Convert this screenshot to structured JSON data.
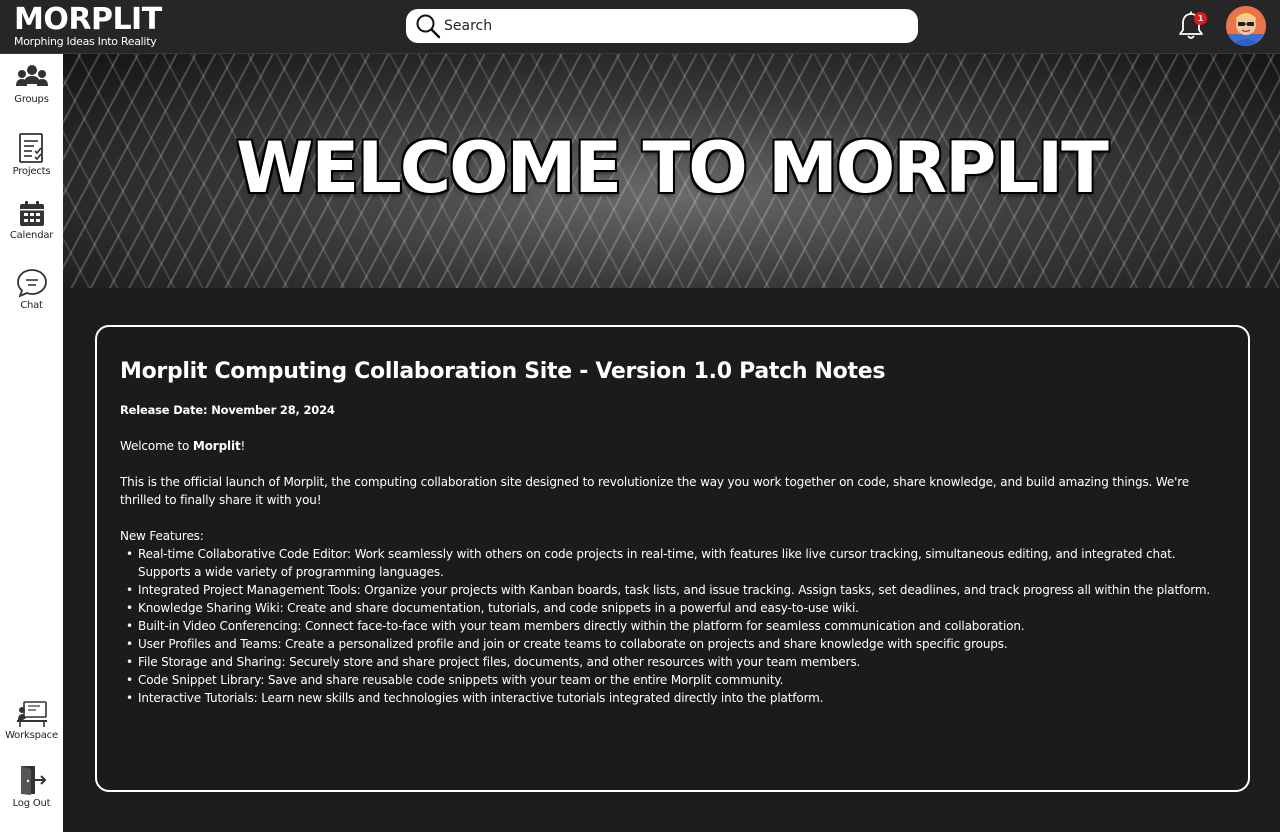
{
  "header": {
    "logo_title": "MORPLIT",
    "logo_tagline": "Morphing Ideas Into Reality",
    "search_placeholder": "Search",
    "notification_count": "1"
  },
  "sidebar": {
    "items": [
      {
        "label": "Groups",
        "icon": "groups-icon"
      },
      {
        "label": "Projects",
        "icon": "projects-icon"
      },
      {
        "label": "Calendar",
        "icon": "calendar-icon"
      },
      {
        "label": "Chat",
        "icon": "chat-icon"
      },
      {
        "label": "Workspace",
        "icon": "workspace-icon"
      },
      {
        "label": "Log Out",
        "icon": "logout-icon"
      }
    ]
  },
  "banner": {
    "title": "WELCOME TO MORPLIT"
  },
  "notes": {
    "title": "Morplit Computing Collaboration Site - Version 1.0 Patch Notes",
    "release_date": "Release Date: November 28, 2024",
    "welcome_prefix": "Welcome to ",
    "welcome_brand": "Morplit",
    "welcome_suffix": "!",
    "intro": "This is the official launch of Morplit, the computing collaboration site designed to revolutionize the way you work together on code, share knowledge, and build amazing things. We're thrilled to finally share it with you!",
    "features_heading": "New Features:",
    "features": [
      "Real-time Collaborative Code Editor: Work seamlessly with others on code projects in real-time, with features like live cursor tracking, simultaneous editing, and integrated chat. Supports a wide variety of programming languages.",
      "Integrated Project Management Tools:  Organize your projects with Kanban boards, task lists, and issue tracking. Assign tasks, set deadlines, and track progress all within the platform.",
      "Knowledge Sharing Wiki:  Create and share documentation, tutorials, and code snippets in a powerful and easy-to-use wiki.",
      "Built-in Video Conferencing:  Connect face-to-face with your team members directly within the platform for seamless communication and collaboration.",
      "User Profiles and Teams: Create a personalized profile and join or create teams to collaborate on projects and share knowledge with specific groups.",
      "File Storage and Sharing: Securely store and share project files, documents, and other resources with your team members.",
      "Code Snippet Library:  Save and share reusable code snippets with your team or the entire Morplit community.",
      "Interactive Tutorials: Learn new skills and technologies with interactive tutorials integrated directly into the platform."
    ]
  }
}
